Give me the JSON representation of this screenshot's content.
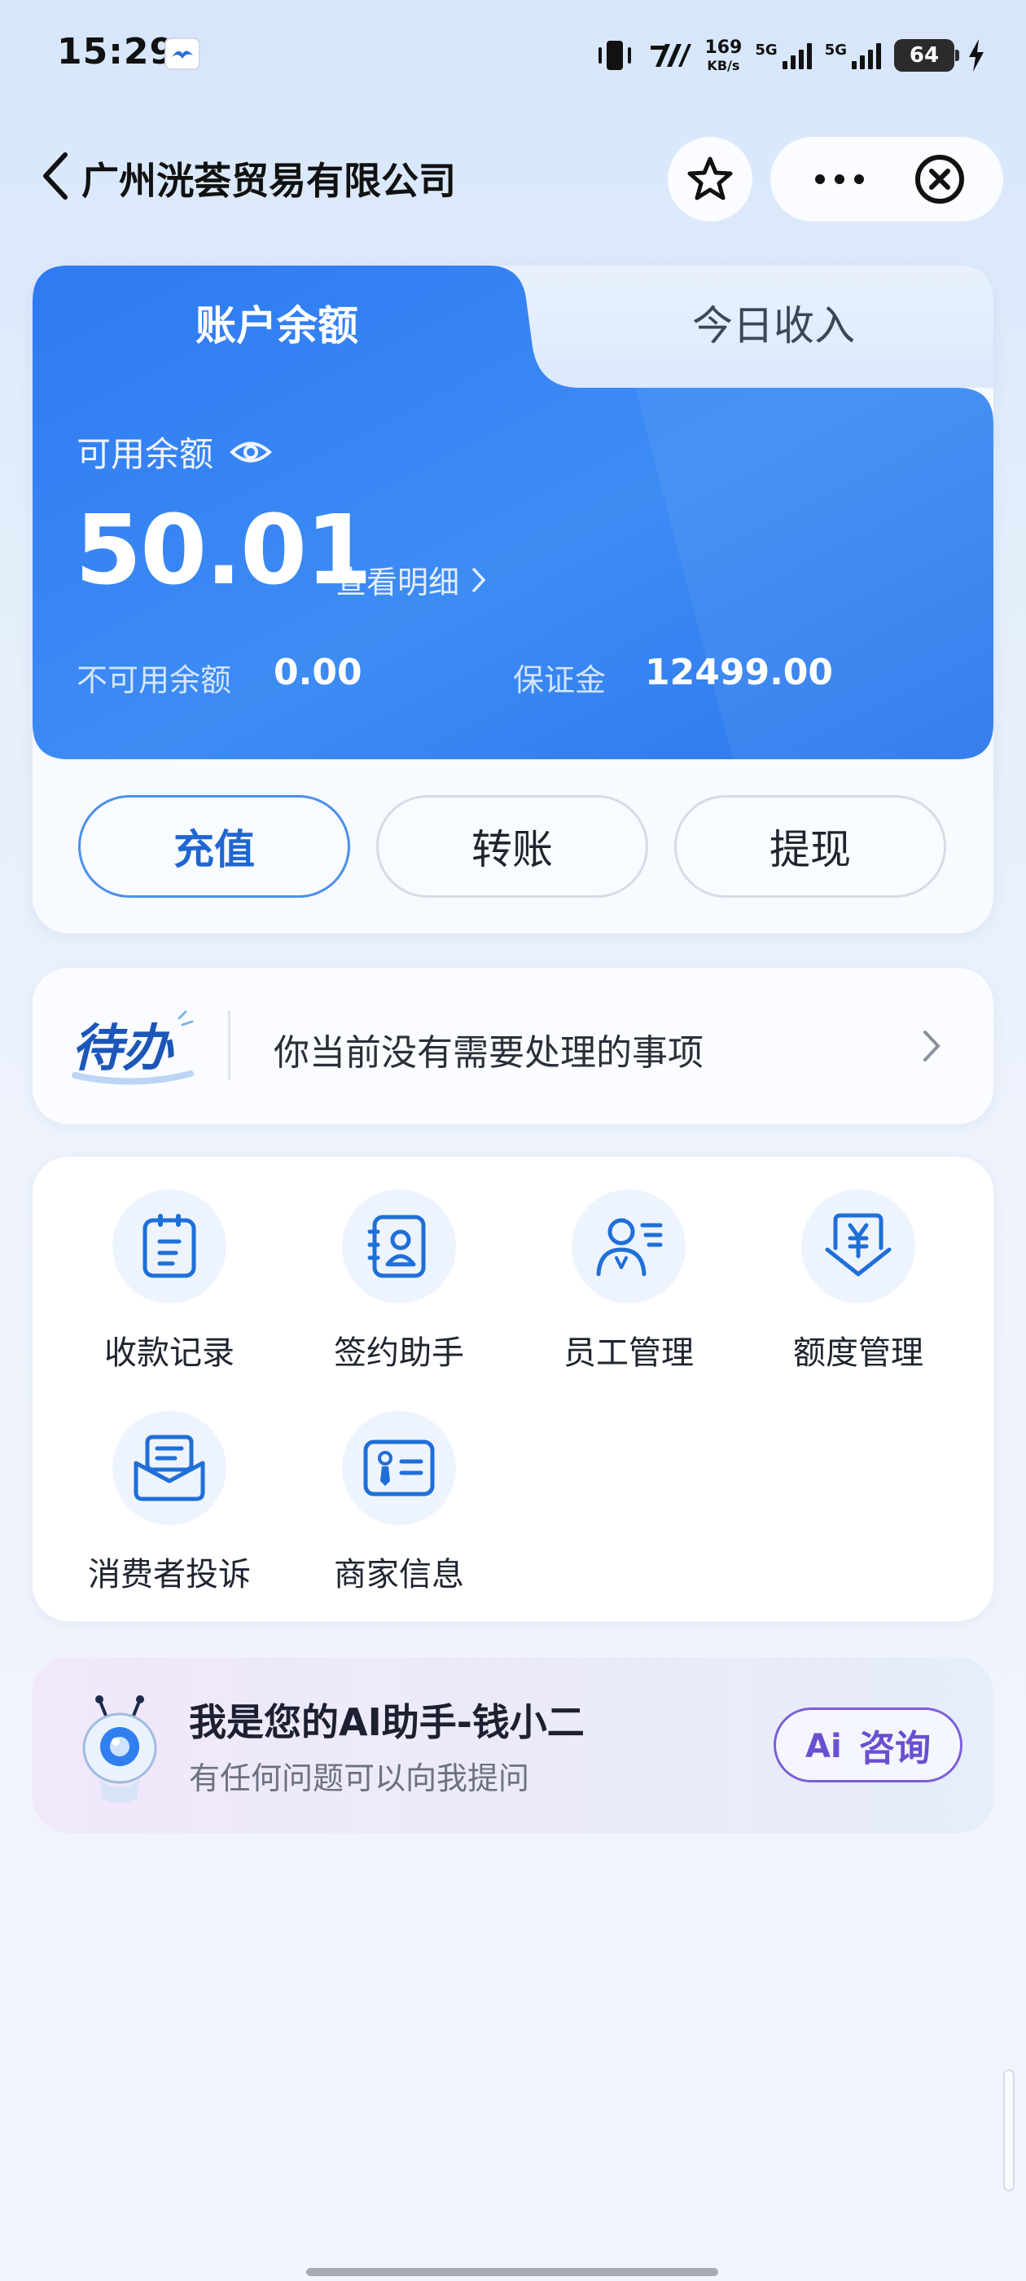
{
  "status_bar": {
    "time": "15:29",
    "net_speed_value": "169",
    "net_speed_unit": "KB/s",
    "signal1_label": "5G",
    "signal2_label": "5G",
    "battery": "64"
  },
  "header": {
    "title": "广州洸荟贸易有限公司",
    "icons": [
      "back-arrow-icon",
      "star-icon",
      "more-icon",
      "close-icon"
    ]
  },
  "balance": {
    "tabs": [
      "账户余额",
      "今日收入"
    ],
    "active_tab": "账户余额",
    "available_label": "可用余额",
    "available_amount": "50.01",
    "detail_link": "查看明细",
    "unavailable_label": "不可用余额",
    "unavailable_amount": "0.00",
    "deposit_label": "保证金",
    "deposit_amount": "12499.00",
    "actions": [
      "充值",
      "转账",
      "提现"
    ],
    "accent_color": "#2f7ff0"
  },
  "todo": {
    "badge": "待办",
    "message": "你当前没有需要处理的事项"
  },
  "menu": {
    "items": [
      {
        "label": "收款记录",
        "icon": "receipt-clipboard-icon"
      },
      {
        "label": "签约助手",
        "icon": "contract-person-icon"
      },
      {
        "label": "员工管理",
        "icon": "staff-manage-icon"
      },
      {
        "label": "额度管理",
        "icon": "yen-quota-icon"
      },
      {
        "label": "消费者投诉",
        "icon": "complaint-mail-icon"
      },
      {
        "label": "商家信息",
        "icon": "merchant-id-card-icon"
      }
    ],
    "icon_color": "#1f6fd8"
  },
  "assistant": {
    "title": "我是您的AI助手-钱小二",
    "subtitle": "有任何问题可以向我提问",
    "button_label": "咨询",
    "button_logo": "Ai"
  }
}
